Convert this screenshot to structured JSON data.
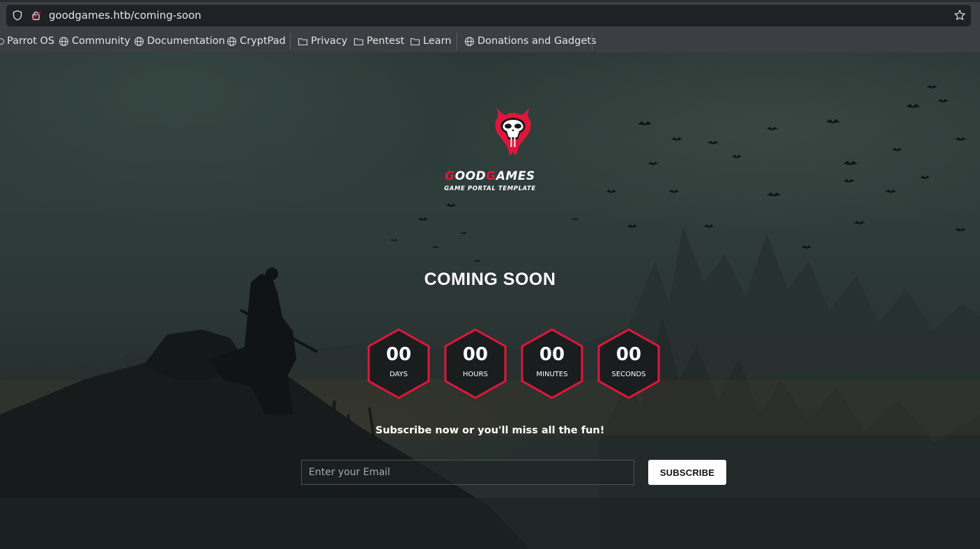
{
  "browser": {
    "url": "goodgames.htb/coming-soon",
    "bookmarks": [
      {
        "label": "Parrot OS",
        "icon": "parrot-icon"
      },
      {
        "label": "Community",
        "icon": "globe-icon"
      },
      {
        "label": "Documentation",
        "icon": "globe-icon"
      },
      {
        "label": "CryptPad",
        "icon": "globe-icon"
      },
      {
        "label": "Privacy",
        "icon": "folder-icon"
      },
      {
        "label": "Pentest",
        "icon": "folder-icon"
      },
      {
        "label": "Learn",
        "icon": "folder-icon"
      },
      {
        "label": "Donations and Gadgets",
        "icon": "globe-icon"
      }
    ]
  },
  "page": {
    "brand_first_initial": "G",
    "brand_first_rest": "OOD",
    "brand_second_initial": "G",
    "brand_second_rest": "AMES",
    "tagline": "GAME PORTAL TEMPLATE",
    "heading": "COMING SOON",
    "countdown": [
      {
        "value": "00",
        "label": "DAYS"
      },
      {
        "value": "00",
        "label": "HOURS"
      },
      {
        "value": "00",
        "label": "MINUTES"
      },
      {
        "value": "00",
        "label": "SECONDS"
      }
    ],
    "subscribe_text": "Subscribe now or you'll miss all the fun!",
    "email_placeholder": "Enter your Email",
    "subscribe_button": "SUBSCRIBE"
  },
  "colors": {
    "accent": "#e0163c",
    "chrome": "#3b3e43",
    "urlbar": "#1f2125"
  }
}
